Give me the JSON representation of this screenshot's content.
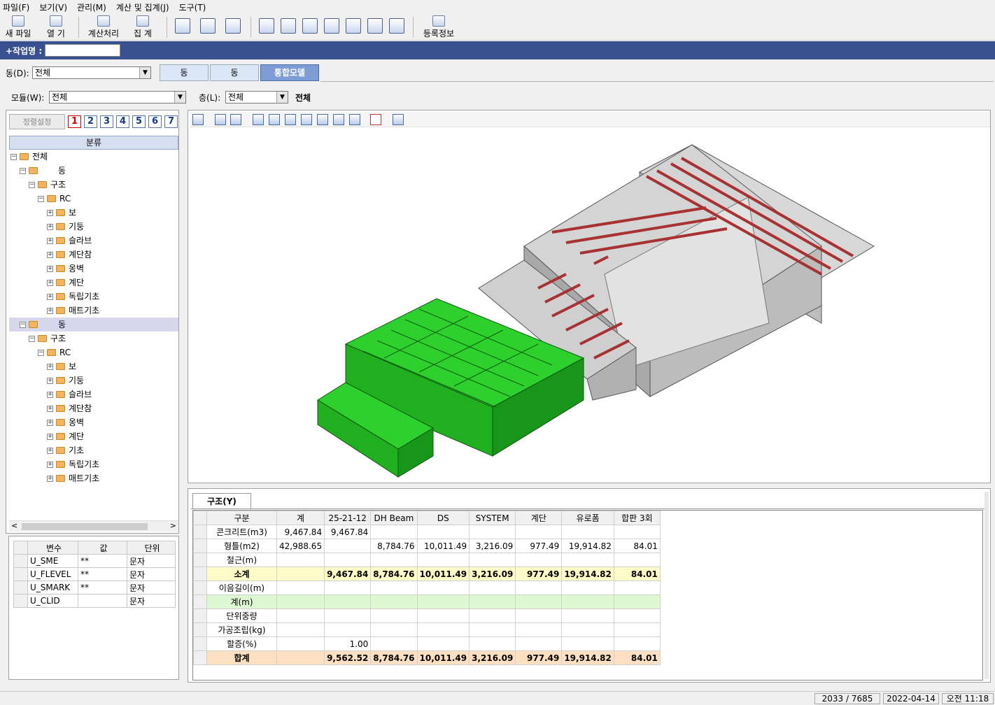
{
  "menu": [
    "파일(F)",
    "보기(V)",
    "관리(M)",
    "계산 및 집계(J)",
    "도구(T)"
  ],
  "toolbar": {
    "new_file": "새 파일",
    "open": "열 기",
    "calc": "계산처리",
    "summary": "집 계",
    "reg_info": "등록정보"
  },
  "job": {
    "label": "+작업명 :",
    "value": ""
  },
  "dong": {
    "label": "동(D):",
    "value": "전체",
    "tabs": [
      "동",
      "동",
      "통합모델"
    ]
  },
  "module": {
    "label": "모듈(W):",
    "value": "전체"
  },
  "floor": {
    "label": "층(L):",
    "value": "전체",
    "display": "전체"
  },
  "left": {
    "sort_button": "정렬설정",
    "levels": [
      "1",
      "2",
      "3",
      "4",
      "5",
      "6",
      "7"
    ],
    "tree_header": "분류",
    "tree": [
      {
        "label": "전체",
        "indent": 0
      },
      {
        "label": "동",
        "indent": 1
      },
      {
        "label": "구조",
        "indent": 2
      },
      {
        "label": "RC",
        "indent": 3
      },
      {
        "label": "보",
        "indent": 4
      },
      {
        "label": "기둥",
        "indent": 4
      },
      {
        "label": "슬라브",
        "indent": 4
      },
      {
        "label": "계단참",
        "indent": 4
      },
      {
        "label": "옹벽",
        "indent": 4
      },
      {
        "label": "계단",
        "indent": 4
      },
      {
        "label": "독립기초",
        "indent": 4
      },
      {
        "label": "매트기초",
        "indent": 4
      },
      {
        "label": "동",
        "indent": 1
      },
      {
        "label": "구조",
        "indent": 2
      },
      {
        "label": "RC",
        "indent": 3
      },
      {
        "label": "보",
        "indent": 4
      },
      {
        "label": "기둥",
        "indent": 4
      },
      {
        "label": "슬라브",
        "indent": 4
      },
      {
        "label": "계단참",
        "indent": 4
      },
      {
        "label": "옹벽",
        "indent": 4
      },
      {
        "label": "계단",
        "indent": 4
      },
      {
        "label": "기초",
        "indent": 4
      },
      {
        "label": "독립기초",
        "indent": 4
      },
      {
        "label": "매트기초",
        "indent": 4
      }
    ]
  },
  "vars": {
    "headers": [
      "변수",
      "값",
      "단위"
    ],
    "rows": [
      [
        "U_SME",
        "**",
        "문자"
      ],
      [
        "U_FLEVEL",
        "**",
        "문자"
      ],
      [
        "U_SMARK",
        "**",
        "문자"
      ],
      [
        "U_CLID",
        "",
        "문자"
      ]
    ]
  },
  "grid": {
    "tab": "구조(Y)",
    "headers": [
      "구분",
      "계",
      "25-21-12",
      "DH Beam",
      "DS",
      "SYSTEM",
      "계단",
      "유로폼",
      "합판 3회"
    ],
    "rows": [
      {
        "type": "normal",
        "cells": [
          "콘크리트(m3)",
          "9,467.84",
          "9,467.84",
          "",
          "",
          "",
          "",
          "",
          ""
        ]
      },
      {
        "type": "normal",
        "cells": [
          "형틀(m2)",
          "42,988.65",
          "",
          "8,784.76",
          "10,011.49",
          "3,216.09",
          "977.49",
          "19,914.82",
          "84.01"
        ]
      },
      {
        "type": "normal",
        "cells": [
          "철근(m)",
          "",
          "",
          "",
          "",
          "",
          "",
          "",
          ""
        ]
      },
      {
        "type": "sub",
        "cells": [
          "소계",
          "",
          "9,467.84",
          "8,784.76",
          "10,011.49",
          "3,216.09",
          "977.49",
          "19,914.82",
          "84.01"
        ]
      },
      {
        "type": "normal",
        "cells": [
          "이음길이(m)",
          "",
          "",
          "",
          "",
          "",
          "",
          "",
          ""
        ]
      },
      {
        "type": "green",
        "cells": [
          "계(m)",
          "",
          "",
          "",
          "",
          "",
          "",
          "",
          ""
        ]
      },
      {
        "type": "normal",
        "cells": [
          "단위중량",
          "",
          "",
          "",
          "",
          "",
          "",
          "",
          ""
        ]
      },
      {
        "type": "normal",
        "cells": [
          "가공조립(kg)",
          "",
          "",
          "",
          "",
          "",
          "",
          "",
          ""
        ]
      },
      {
        "type": "normal",
        "cells": [
          "할증(%)",
          "",
          "1.00",
          "",
          "",
          "",
          "",
          "",
          ""
        ]
      },
      {
        "type": "total",
        "cells": [
          "합계",
          "",
          "9,562.52",
          "8,784.76",
          "10,011.49",
          "3,216.09",
          "977.49",
          "19,914.82",
          "84.01"
        ]
      }
    ]
  },
  "status": {
    "count": "2033 / 7685",
    "date": "2022-04-14",
    "time": "오전 11:18"
  },
  "colors": {
    "header_blue": "#3a5190",
    "model_green": "#22cc22",
    "model_red": "#a83232",
    "model_gray": "#cfcfcf"
  }
}
